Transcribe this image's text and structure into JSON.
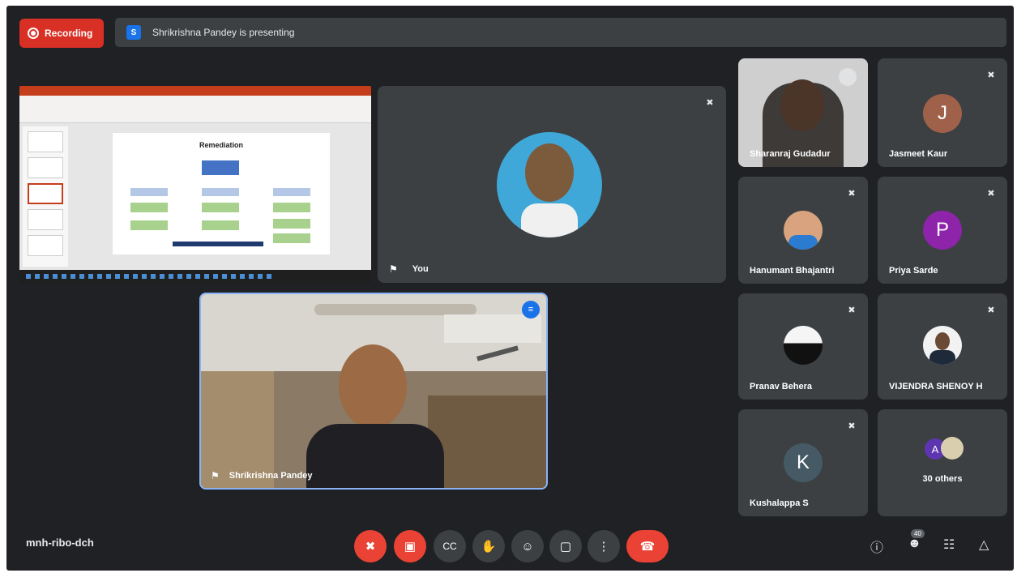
{
  "recording": {
    "label": "Recording"
  },
  "presenting": {
    "avatar_letter": "S",
    "text": "Shrikrishna Pandey is presenting"
  },
  "shared_slide": {
    "title": "Remediation"
  },
  "main": {
    "you_tile": {
      "name": "You"
    },
    "speaker_tile": {
      "name": "Shrikrishna Pandey"
    }
  },
  "participants": [
    {
      "name": "Sharanraj Gudadur",
      "type": "video"
    },
    {
      "name": "Jasmeet Kaur",
      "initial": "J",
      "avatar_color": "#a0614b"
    },
    {
      "name": "Hanumant Bhajantri",
      "type": "photo"
    },
    {
      "name": "Priya Sarde",
      "initial": "P",
      "avatar_color": "#8e24aa"
    },
    {
      "name": "Pranav Behera",
      "type": "photo"
    },
    {
      "name": "VIJENDRA SHENOY H",
      "type": "photo"
    },
    {
      "name": "Kushalappa S",
      "initial": "K",
      "avatar_color": "#455a64"
    },
    {
      "name": "30 others",
      "initial": "A",
      "avatar_color": "#5e35b1"
    }
  ],
  "controls": {
    "meeting_code": "mnh-ribo-dch",
    "buttons": [
      "mic-off",
      "camera-off",
      "captions",
      "raise-hand",
      "present",
      "more",
      "hang-up"
    ],
    "people_count": "40"
  },
  "colors": {
    "background": "#202124",
    "tile": "#3c4043",
    "danger": "#ea4335",
    "accent": "#1a73e8"
  }
}
